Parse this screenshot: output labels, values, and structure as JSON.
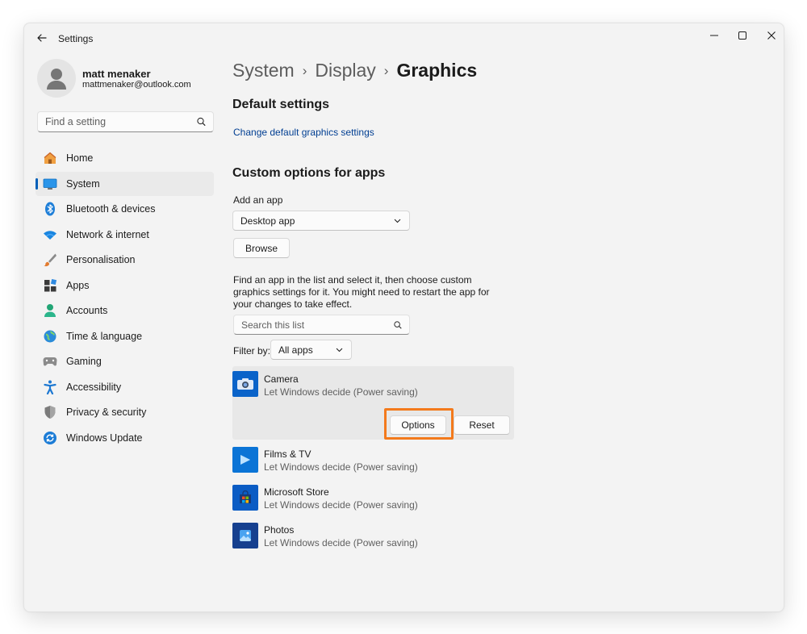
{
  "window": {
    "title": "Settings",
    "controls": [
      "minimize",
      "maximize",
      "close"
    ]
  },
  "user": {
    "name": "matt menaker",
    "email": "mattmenaker@outlook.com"
  },
  "search": {
    "placeholder": "Find a setting"
  },
  "sidebar": {
    "items": [
      {
        "label": "Home",
        "icon": "home-icon",
        "active": false
      },
      {
        "label": "System",
        "icon": "system-icon",
        "active": true
      },
      {
        "label": "Bluetooth & devices",
        "icon": "bluetooth-icon",
        "active": false
      },
      {
        "label": "Network & internet",
        "icon": "wifi-icon",
        "active": false
      },
      {
        "label": "Personalisation",
        "icon": "brush-icon",
        "active": false
      },
      {
        "label": "Apps",
        "icon": "apps-icon",
        "active": false
      },
      {
        "label": "Accounts",
        "icon": "accounts-icon",
        "active": false
      },
      {
        "label": "Time & language",
        "icon": "globe-icon",
        "active": false
      },
      {
        "label": "Gaming",
        "icon": "controller-icon",
        "active": false
      },
      {
        "label": "Accessibility",
        "icon": "accessibility-icon",
        "active": false
      },
      {
        "label": "Privacy & security",
        "icon": "shield-icon",
        "active": false
      },
      {
        "label": "Windows Update",
        "icon": "update-icon",
        "active": false
      }
    ]
  },
  "breadcrumb": [
    "System",
    "Display",
    "Graphics"
  ],
  "default_settings": {
    "heading": "Default settings",
    "link": "Change default graphics settings"
  },
  "custom": {
    "heading": "Custom options for apps",
    "add_app_label": "Add an app",
    "app_type_value": "Desktop app",
    "browse_label": "Browse",
    "description": "Find an app in the list and select it, then choose custom graphics settings for it. You might need to restart the app for your changes to take effect.",
    "list_search_placeholder": "Search this list",
    "filter_label": "Filter by:",
    "filter_value": "All apps"
  },
  "apps": [
    {
      "name": "Camera",
      "status": "Let Windows decide (Power saving)",
      "icon": "camera-icon",
      "color": "#0a63c9",
      "expanded": true
    },
    {
      "name": "Films & TV",
      "status": "Let Windows decide (Power saving)",
      "icon": "films-tv-icon",
      "color": "#0b74d6",
      "expanded": false
    },
    {
      "name": "Microsoft Store",
      "status": "Let Windows decide (Power saving)",
      "icon": "store-icon",
      "color": "#0b5cc4",
      "expanded": false
    },
    {
      "name": "Photos",
      "status": "Let Windows decide (Power saving)",
      "icon": "photos-icon",
      "color": "#16408f",
      "expanded": false
    }
  ],
  "card_actions": {
    "options_label": "Options",
    "reset_label": "Reset"
  },
  "colors": {
    "accent": "#005fb8",
    "highlight": "#f37a1c",
    "window_bg": "#f3f3f3"
  }
}
